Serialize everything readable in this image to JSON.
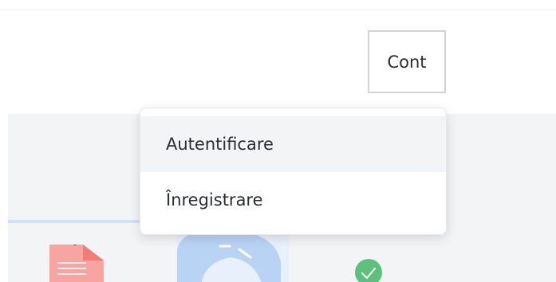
{
  "header": {
    "account_label": "Cont"
  },
  "dropdown": {
    "items": [
      {
        "label": "Autentificare",
        "highlighted": true
      },
      {
        "label": "Înregistrare",
        "highlighted": false
      }
    ]
  },
  "illustration": {
    "icons": [
      "document-icon",
      "gear-icon",
      "check-icon"
    ],
    "colors": {
      "document": "#f8a5a2",
      "gear": "#b9d3f4",
      "check": "#5cc17a",
      "band": "#f3f4f6",
      "line": "#cfe1fa"
    }
  }
}
